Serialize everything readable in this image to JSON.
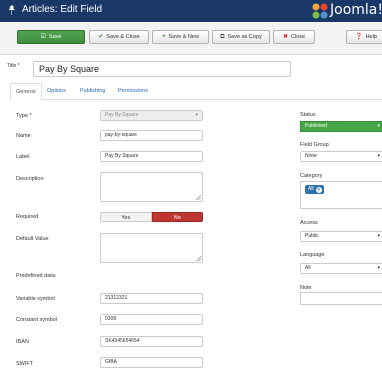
{
  "header": {
    "title": "Articles: Edit Field",
    "brand": "Joomla!"
  },
  "toolbar": {
    "save": "Save",
    "save_close": "Save & Close",
    "save_new": "Save & New",
    "save_copy": "Save as Copy",
    "close": "Close",
    "help": "Help"
  },
  "title_field": {
    "label": "Title *",
    "value": "Pay By Square"
  },
  "tabs": [
    "General",
    "Options",
    "Publishing",
    "Permissions"
  ],
  "form": {
    "type": {
      "label": "Type *",
      "value": "Pay By Square"
    },
    "name": {
      "label": "Name",
      "value": "pay-by-square"
    },
    "field_label": {
      "label": "Label",
      "value": "Pay By Square"
    },
    "description": {
      "label": "Description"
    },
    "required": {
      "label": "Required",
      "yes": "Yes",
      "no": "No",
      "selected": "No"
    },
    "default_value": {
      "label": "Default Value"
    },
    "predefined": {
      "label": "Predefined data:"
    },
    "variable_symbol": {
      "label": "Variable symbol",
      "value": "21312321"
    },
    "constant_symbol": {
      "label": "Constant symbol",
      "value": "0308"
    },
    "iban": {
      "label": "IBAN",
      "value": "SK4545654654"
    },
    "swift": {
      "label": "SWIFT",
      "value": "GIBA"
    }
  },
  "sidebar": {
    "status": {
      "label": "Status",
      "value": "Published"
    },
    "field_group": {
      "label": "Field Group",
      "value": "None"
    },
    "category": {
      "label": "Category",
      "chip": "All"
    },
    "access": {
      "label": "Access",
      "value": "Public"
    },
    "language": {
      "label": "Language",
      "value": "All"
    },
    "note": {
      "label": "Note"
    }
  },
  "colors": {
    "header": "#1a3867",
    "save": "#46a546",
    "no": "#bd362f",
    "status": "#46a546",
    "link": "#2a69b8"
  }
}
